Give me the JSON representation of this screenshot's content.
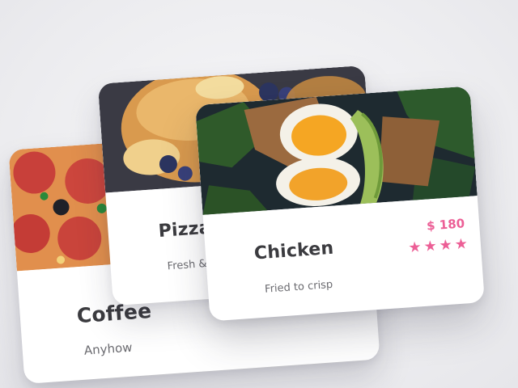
{
  "cards": {
    "coffee": {
      "title": "Coffee",
      "subtitle": "Anyhow",
      "image_icon": "pizza-photo"
    },
    "pizza": {
      "title": "Pizza",
      "subtitle": "Fresh & sw",
      "image_icon": "pancakes-photo"
    },
    "chicken": {
      "title": "Chicken",
      "subtitle": "Fried to crisp",
      "price": "$ 180",
      "rating": 4,
      "rating_max": 4,
      "image_icon": "egg-avocado-toast-photo"
    }
  },
  "colors": {
    "accent": "#ec5f96",
    "title": "#3b3b3f",
    "subtitle": "#6b6b70",
    "background": "#efeff2"
  }
}
